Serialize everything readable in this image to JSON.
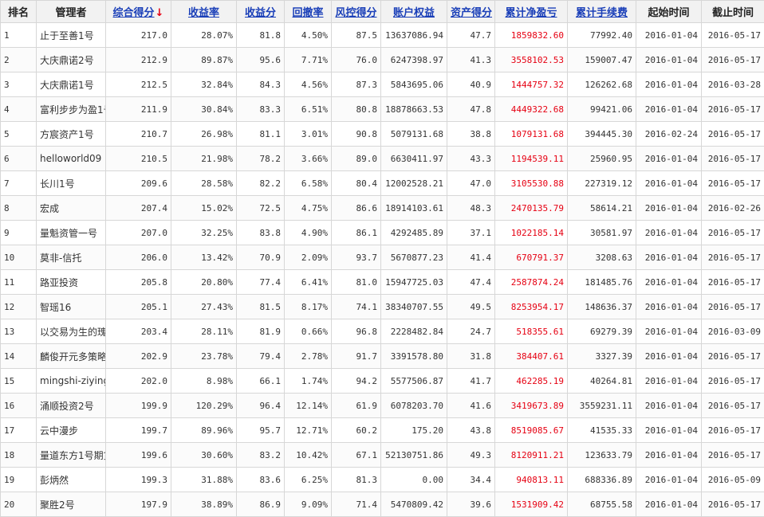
{
  "headers": {
    "rank": "排名",
    "manager": "管理者",
    "composite": "综合得分",
    "return_rate": "收益率",
    "return_score": "收益分",
    "drawdown": "回撤率",
    "risk_score": "风控得分",
    "equity": "账户权益",
    "asset_score": "资产得分",
    "net_profit": "累计净盈亏",
    "fees": "累计手续费",
    "start": "起始时间",
    "end": "截止时间"
  },
  "sort_arrow": "↓",
  "colors": {
    "link": "#1a3fb8",
    "profit": "#e60012"
  },
  "rows": [
    {
      "rank": "1",
      "manager": "止于至善1号",
      "composite": "217.0",
      "return_rate": "28.07%",
      "return_score": "81.8",
      "drawdown": "4.50%",
      "risk_score": "87.5",
      "equity": "13637086.94",
      "asset_score": "47.7",
      "net_profit": "1859832.60",
      "fees": "77992.40",
      "start": "2016-01-04",
      "end": "2016-05-17"
    },
    {
      "rank": "2",
      "manager": "大庆鼎诺2号",
      "composite": "212.9",
      "return_rate": "89.87%",
      "return_score": "95.6",
      "drawdown": "7.71%",
      "risk_score": "76.0",
      "equity": "6247398.97",
      "asset_score": "41.3",
      "net_profit": "3558102.53",
      "fees": "159007.47",
      "start": "2016-01-04",
      "end": "2016-05-17"
    },
    {
      "rank": "3",
      "manager": "大庆鼎诺1号",
      "composite": "212.5",
      "return_rate": "32.84%",
      "return_score": "84.3",
      "drawdown": "4.56%",
      "risk_score": "87.3",
      "equity": "5843695.06",
      "asset_score": "40.9",
      "net_profit": "1444757.32",
      "fees": "126262.68",
      "start": "2016-01-04",
      "end": "2016-03-28"
    },
    {
      "rank": "4",
      "manager": "富利步步为盈1号",
      "composite": "211.9",
      "return_rate": "30.84%",
      "return_score": "83.3",
      "drawdown": "6.51%",
      "risk_score": "80.8",
      "equity": "18878663.53",
      "asset_score": "47.8",
      "net_profit": "4449322.68",
      "fees": "99421.06",
      "start": "2016-01-04",
      "end": "2016-05-17"
    },
    {
      "rank": "5",
      "manager": "方宸资产1号",
      "composite": "210.7",
      "return_rate": "26.98%",
      "return_score": "81.1",
      "drawdown": "3.01%",
      "risk_score": "90.8",
      "equity": "5079131.68",
      "asset_score": "38.8",
      "net_profit": "1079131.68",
      "fees": "394445.30",
      "start": "2016-02-24",
      "end": "2016-05-17"
    },
    {
      "rank": "6",
      "manager": "helloworld09",
      "composite": "210.5",
      "return_rate": "21.98%",
      "return_score": "78.2",
      "drawdown": "3.66%",
      "risk_score": "89.0",
      "equity": "6630411.97",
      "asset_score": "43.3",
      "net_profit": "1194539.11",
      "fees": "25960.95",
      "start": "2016-01-04",
      "end": "2016-05-17"
    },
    {
      "rank": "7",
      "manager": "长川1号",
      "composite": "209.6",
      "return_rate": "28.58%",
      "return_score": "82.2",
      "drawdown": "6.58%",
      "risk_score": "80.4",
      "equity": "12002528.21",
      "asset_score": "47.0",
      "net_profit": "3105530.88",
      "fees": "227319.12",
      "start": "2016-01-04",
      "end": "2016-05-17"
    },
    {
      "rank": "8",
      "manager": "宏成",
      "composite": "207.4",
      "return_rate": "15.02%",
      "return_score": "72.5",
      "drawdown": "4.75%",
      "risk_score": "86.6",
      "equity": "18914103.61",
      "asset_score": "48.3",
      "net_profit": "2470135.79",
      "fees": "58614.21",
      "start": "2016-01-04",
      "end": "2016-02-26"
    },
    {
      "rank": "9",
      "manager": "量魁资管一号",
      "composite": "207.0",
      "return_rate": "32.25%",
      "return_score": "83.8",
      "drawdown": "4.90%",
      "risk_score": "86.1",
      "equity": "4292485.89",
      "asset_score": "37.1",
      "net_profit": "1022185.14",
      "fees": "30581.97",
      "start": "2016-01-04",
      "end": "2016-05-17"
    },
    {
      "rank": "10",
      "manager": "莫非-信托",
      "composite": "206.0",
      "return_rate": "13.42%",
      "return_score": "70.9",
      "drawdown": "2.09%",
      "risk_score": "93.7",
      "equity": "5670877.23",
      "asset_score": "41.4",
      "net_profit": "670791.37",
      "fees": "3208.63",
      "start": "2016-01-04",
      "end": "2016-05-17"
    },
    {
      "rank": "11",
      "manager": "路亚投资",
      "composite": "205.8",
      "return_rate": "20.80%",
      "return_score": "77.4",
      "drawdown": "6.41%",
      "risk_score": "81.0",
      "equity": "15947725.03",
      "asset_score": "47.4",
      "net_profit": "2587874.24",
      "fees": "181485.76",
      "start": "2016-01-04",
      "end": "2016-05-17"
    },
    {
      "rank": "12",
      "manager": "智瑶16",
      "composite": "205.1",
      "return_rate": "27.43%",
      "return_score": "81.5",
      "drawdown": "8.17%",
      "risk_score": "74.1",
      "equity": "38340707.55",
      "asset_score": "49.5",
      "net_profit": "8253954.17",
      "fees": "148636.37",
      "start": "2016-01-04",
      "end": "2016-05-17"
    },
    {
      "rank": "13",
      "manager": "以交易为生的瑰",
      "composite": "203.4",
      "return_rate": "28.11%",
      "return_score": "81.9",
      "drawdown": "0.66%",
      "risk_score": "96.8",
      "equity": "2228482.84",
      "asset_score": "24.7",
      "net_profit": "518355.61",
      "fees": "69279.39",
      "start": "2016-01-04",
      "end": "2016-03-09"
    },
    {
      "rank": "14",
      "manager": "麟俊开元多策略",
      "composite": "202.9",
      "return_rate": "23.78%",
      "return_score": "79.4",
      "drawdown": "2.78%",
      "risk_score": "91.7",
      "equity": "3391578.80",
      "asset_score": "31.8",
      "net_profit": "384407.61",
      "fees": "3327.39",
      "start": "2016-01-04",
      "end": "2016-05-17"
    },
    {
      "rank": "15",
      "manager": "mingshi-ziying",
      "composite": "202.0",
      "return_rate": "8.98%",
      "return_score": "66.1",
      "drawdown": "1.74%",
      "risk_score": "94.2",
      "equity": "5577506.87",
      "asset_score": "41.7",
      "net_profit": "462285.19",
      "fees": "40264.81",
      "start": "2016-01-04",
      "end": "2016-05-17"
    },
    {
      "rank": "16",
      "manager": "涌顺投资2号",
      "composite": "199.9",
      "return_rate": "120.29%",
      "return_score": "96.4",
      "drawdown": "12.14%",
      "risk_score": "61.9",
      "equity": "6078203.70",
      "asset_score": "41.6",
      "net_profit": "3419673.89",
      "fees": "3559231.11",
      "start": "2016-01-04",
      "end": "2016-05-17"
    },
    {
      "rank": "17",
      "manager": "云中漫步",
      "composite": "199.7",
      "return_rate": "89.96%",
      "return_score": "95.7",
      "drawdown": "12.71%",
      "risk_score": "60.2",
      "equity": "175.20",
      "asset_score": "43.8",
      "net_profit": "8519085.67",
      "fees": "41535.33",
      "start": "2016-01-04",
      "end": "2016-05-17"
    },
    {
      "rank": "18",
      "manager": "量道东方1号期货",
      "composite": "199.6",
      "return_rate": "30.60%",
      "return_score": "83.2",
      "drawdown": "10.42%",
      "risk_score": "67.1",
      "equity": "52130751.86",
      "asset_score": "49.3",
      "net_profit": "8120911.21",
      "fees": "123633.79",
      "start": "2016-01-04",
      "end": "2016-05-17"
    },
    {
      "rank": "19",
      "manager": "彭炳然",
      "composite": "199.3",
      "return_rate": "31.88%",
      "return_score": "83.6",
      "drawdown": "6.25%",
      "risk_score": "81.3",
      "equity": "0.00",
      "asset_score": "34.4",
      "net_profit": "940813.11",
      "fees": "688336.89",
      "start": "2016-01-04",
      "end": "2016-05-09"
    },
    {
      "rank": "20",
      "manager": "聚胜2号",
      "composite": "197.9",
      "return_rate": "38.89%",
      "return_score": "86.9",
      "drawdown": "9.09%",
      "risk_score": "71.4",
      "equity": "5470809.42",
      "asset_score": "39.6",
      "net_profit": "1531909.42",
      "fees": "68755.58",
      "start": "2016-01-04",
      "end": "2016-05-17"
    }
  ]
}
